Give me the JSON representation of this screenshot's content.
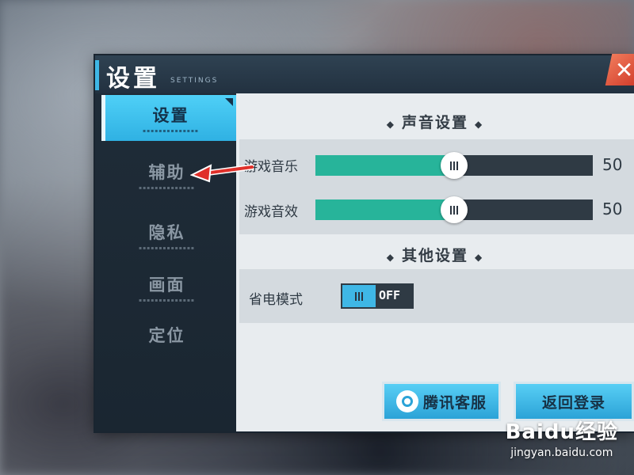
{
  "window": {
    "title": "设置",
    "subtitle": "SETTINGS",
    "close_icon": "close-icon"
  },
  "sidebar": {
    "items": [
      {
        "label": "设置",
        "active": true
      },
      {
        "label": "辅助",
        "active": false
      },
      {
        "label": "隐私",
        "active": false
      },
      {
        "label": "画面",
        "active": false
      },
      {
        "label": "定位",
        "active": false
      }
    ]
  },
  "sound": {
    "section_title": "声音设置",
    "music": {
      "label": "游戏音乐",
      "value": "50",
      "level": 0.5
    },
    "effects": {
      "label": "游戏音效",
      "value": "50",
      "level": 0.5
    }
  },
  "other": {
    "section_title": "其他设置",
    "power_saving": {
      "label": "省电模式",
      "state": "OFF"
    }
  },
  "actions": {
    "customer_service": "腾讯客服",
    "return_login": "返回登录"
  },
  "watermark": {
    "brand": "Baidu经验",
    "url": "jingyan.baidu.com"
  },
  "colors": {
    "accent": "#3fb7e6",
    "slider_fill": "#27b49a",
    "close": "#d13b2a",
    "arrow": "#e0302a"
  }
}
